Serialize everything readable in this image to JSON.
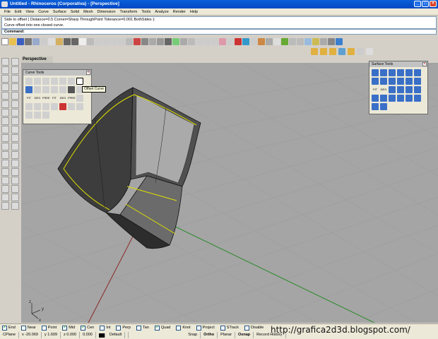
{
  "window": {
    "title": "Untitled - Rhinoceros (Corporativa) - [Perspective]"
  },
  "menu": [
    "File",
    "Edit",
    "View",
    "Curve",
    "Surface",
    "Solid",
    "Mesh",
    "Dimension",
    "Transform",
    "Tools",
    "Analyze",
    "Render",
    "Help"
  ],
  "command_history": {
    "line1": "Side to offset ( Distance=0.5  Corner=Sharp  ThroughPoint  Tolerance=0.001  BothSides ):",
    "line2": "Curve offset into one closed curve."
  },
  "command_prompt": "Command:",
  "viewport": {
    "label": "Perspective",
    "axis_x": "x",
    "axis_y": "y",
    "axis_z": "z"
  },
  "curve_tools": {
    "title": "Curve Tools",
    "tooltip": "Offset Curve",
    "labels": [
      "FIT",
      "DEG",
      "FREE",
      "FIT",
      "DEG",
      "FREE"
    ]
  },
  "surface_tools": {
    "title": "Surface Tools",
    "labels": [
      "FIT",
      "DEG"
    ]
  },
  "osnaps": [
    {
      "label": "End",
      "checked": true
    },
    {
      "label": "Near",
      "checked": false
    },
    {
      "label": "Point",
      "checked": false
    },
    {
      "label": "Mid",
      "checked": true
    },
    {
      "label": "Cen",
      "checked": true
    },
    {
      "label": "Int",
      "checked": false
    },
    {
      "label": "Perp",
      "checked": false
    },
    {
      "label": "Tan",
      "checked": false
    },
    {
      "label": "Quad",
      "checked": true
    },
    {
      "label": "Knot",
      "checked": false
    },
    {
      "label": "Project",
      "checked": false
    },
    {
      "label": "STrack",
      "checked": false
    },
    {
      "label": "Disable",
      "checked": false
    }
  ],
  "status": {
    "cplane": "CPlane",
    "x": "x -20.069",
    "y": "y 1.699",
    "z": "z 0.000",
    "distance": "0.000",
    "layer": "Default",
    "snap": "Snap",
    "ortho": "Ortho",
    "planar": "Planar",
    "osnap": "Osnap",
    "record_history": "Record History"
  },
  "watermark": "http://grafica2d3d.blogspot.com/",
  "colors": {
    "accent": "#0a5fd8",
    "viewport": "#a5a5a5",
    "selection": "#e0e000"
  }
}
